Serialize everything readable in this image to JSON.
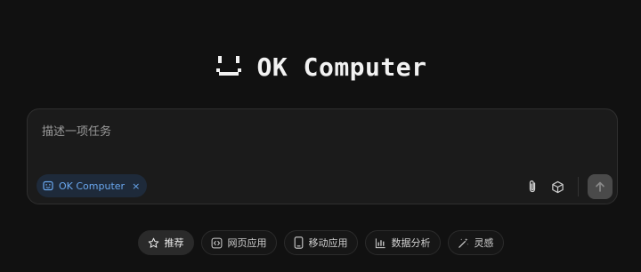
{
  "brand": {
    "title": "OK Computer"
  },
  "prompt": {
    "placeholder": "描述一项任务",
    "value": ""
  },
  "mode_chip": {
    "label": "OK Computer",
    "close_glyph": "×",
    "icon": "computer-face-icon"
  },
  "tools": {
    "attach_icon": "paperclip-icon",
    "cube_icon": "cube-icon",
    "send_icon": "arrow-up-icon"
  },
  "suggestions": [
    {
      "label": "推荐",
      "icon": "star-icon",
      "active": true
    },
    {
      "label": "网页应用",
      "icon": "code-icon",
      "active": false
    },
    {
      "label": "移动应用",
      "icon": "phone-icon",
      "active": false
    },
    {
      "label": "数据分析",
      "icon": "bar-chart-icon",
      "active": false
    },
    {
      "label": "灵感",
      "icon": "magic-wand-icon",
      "active": false
    }
  ],
  "colors": {
    "background": "#111111",
    "card": "#1b1b1b",
    "accent": "#6aa8f0"
  }
}
